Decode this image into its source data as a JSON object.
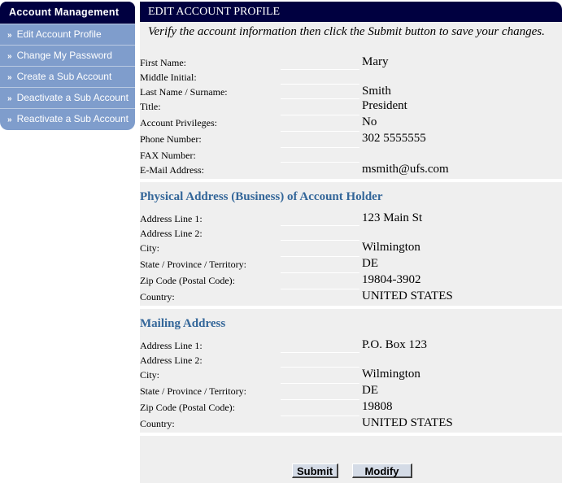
{
  "sidebar": {
    "title": "Account Management",
    "arrow": "»",
    "items": [
      {
        "label": "Edit Account Profile"
      },
      {
        "label": "Change My Password"
      },
      {
        "label": "Create a  Sub Account"
      },
      {
        "label": "Deactivate a Sub Account"
      },
      {
        "label": "Reactivate a Sub Account"
      }
    ]
  },
  "main": {
    "title": "EDIT ACCOUNT PROFILE",
    "intro": "Verify the account information then click the Submit button to save your changes.",
    "personal": [
      {
        "label": "First Name:",
        "value": "Mary"
      },
      {
        "label": "Middle Initial:",
        "value": ""
      },
      {
        "label": "Last Name / Surname:",
        "value": "Smith"
      },
      {
        "label": "Title:",
        "value": "President"
      },
      {
        "label": "Account Privileges:",
        "value": "No"
      },
      {
        "label": "Phone Number:",
        "value": "302 5555555"
      },
      {
        "label": "FAX Number:",
        "value": ""
      },
      {
        "label": "E-Mail Address:",
        "value": "msmith@ufs.com"
      }
    ],
    "physical_title": "Physical Address (Business) of Account Holder",
    "physical": [
      {
        "label": "Address Line 1:",
        "value": "123 Main St"
      },
      {
        "label": "Address Line 2:",
        "value": ""
      },
      {
        "label": "City:",
        "value": "Wilmington"
      },
      {
        "label": "State / Province / Territory:",
        "value": "DE"
      },
      {
        "label": "Zip Code (Postal Code):",
        "value": "19804-3902"
      },
      {
        "label": "Country:",
        "value": "UNITED STATES"
      }
    ],
    "mailing_title": "Mailing Address",
    "mailing": [
      {
        "label": "Address Line 1:",
        "value": "P.O. Box 123"
      },
      {
        "label": "Address Line 2:",
        "value": ""
      },
      {
        "label": "City:",
        "value": "Wilmington"
      },
      {
        "label": "State / Province / Territory:",
        "value": "DE"
      },
      {
        "label": "Zip Code (Postal Code):",
        "value": "19808"
      },
      {
        "label": "Country:",
        "value": "UNITED STATES"
      }
    ],
    "buttons": {
      "submit": "Submit",
      "modify": "Modify"
    }
  },
  "colors": {
    "header_bg": "#000040",
    "sidebar_item_bg": "#7f9dcc",
    "section_title": "#336699",
    "panel_bg": "#efefef"
  }
}
